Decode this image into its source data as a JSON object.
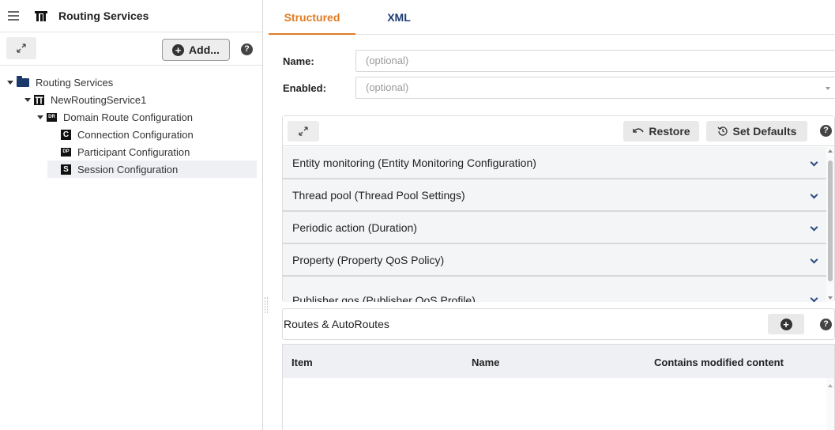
{
  "sidebar": {
    "title": "Routing Services",
    "add_label": "Add...",
    "help_label": "?",
    "tree": [
      {
        "label": "Routing Services"
      },
      {
        "label": "NewRoutingService1"
      },
      {
        "label": "Domain Route Configuration",
        "badge": "DR"
      },
      {
        "label": "Connection Configuration",
        "badge": "C"
      },
      {
        "label": "Participant Configuration",
        "badge": "DP"
      },
      {
        "label": "Session Configuration",
        "badge": "S"
      }
    ]
  },
  "tabs": [
    {
      "label": "Structured",
      "active": true
    },
    {
      "label": "XML",
      "active": false
    }
  ],
  "form": {
    "name_label": "Name:",
    "name_placeholder": "(optional)",
    "enabled_label": "Enabled:",
    "enabled_placeholder": "(optional)"
  },
  "panel": {
    "restore_label": "Restore",
    "defaults_label": "Set Defaults",
    "help_label": "?",
    "sections": [
      "Entity monitoring (Entity Monitoring Configuration)",
      "Thread pool (Thread Pool Settings)",
      "Periodic action (Duration)",
      "Property (Property QoS Policy)",
      "Publisher qos (Publisher QoS Profile)"
    ]
  },
  "routes": {
    "title": "Routes & AutoRoutes",
    "help_label": "?",
    "columns": [
      "Item",
      "Name",
      "Contains modified content"
    ]
  },
  "colors": {
    "accent": "#e07b22",
    "tab_inactive": "#1f3c75"
  }
}
